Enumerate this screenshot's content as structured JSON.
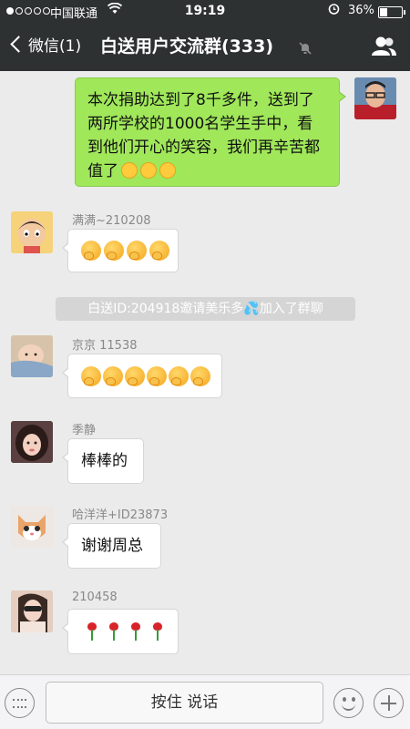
{
  "status_bar": {
    "carrier": "中国联通",
    "time": "19:19",
    "battery_text": "36%",
    "battery_level": 0.36,
    "signal_strength": 1
  },
  "header": {
    "back_label": "微信(1)",
    "title": "白送用户交流群(333)"
  },
  "messages": {
    "own": {
      "text": "本次捐助达到了8千多件，送到了两所学校的1000名学生手中，看到他们开心的笑容，我们再辛苦都值了",
      "emoji": "smile-emoji",
      "emoji_count": 3
    },
    "m1": {
      "sender": "满满~210208",
      "emoji": "praying-face-emoji",
      "emoji_count": 4
    },
    "system": "白送ID:204918邀请美乐多💦加入了群聊",
    "m2": {
      "sender": "京京 11538",
      "emoji": "praying-face-emoji",
      "emoji_count": 6
    },
    "m3": {
      "sender": "季静",
      "text": "棒棒的"
    },
    "m4": {
      "sender": "哈洋洋+ID23873",
      "text": "谢谢周总"
    },
    "m5": {
      "sender": "210458",
      "emoji": "rose-emoji",
      "emoji_count": 4
    }
  },
  "input_bar": {
    "voice_label": "按住 说话"
  },
  "icons": {
    "back": "chevron-left-icon",
    "mute": "mute-bell-icon",
    "members": "group-members-icon",
    "keyboard": "keyboard-icon",
    "emoji": "emoji-icon",
    "plus": "plus-icon"
  },
  "colors": {
    "header_bg": "#2e3132",
    "chat_bg": "#ebebeb",
    "own_bubble": "#a0e75a"
  }
}
